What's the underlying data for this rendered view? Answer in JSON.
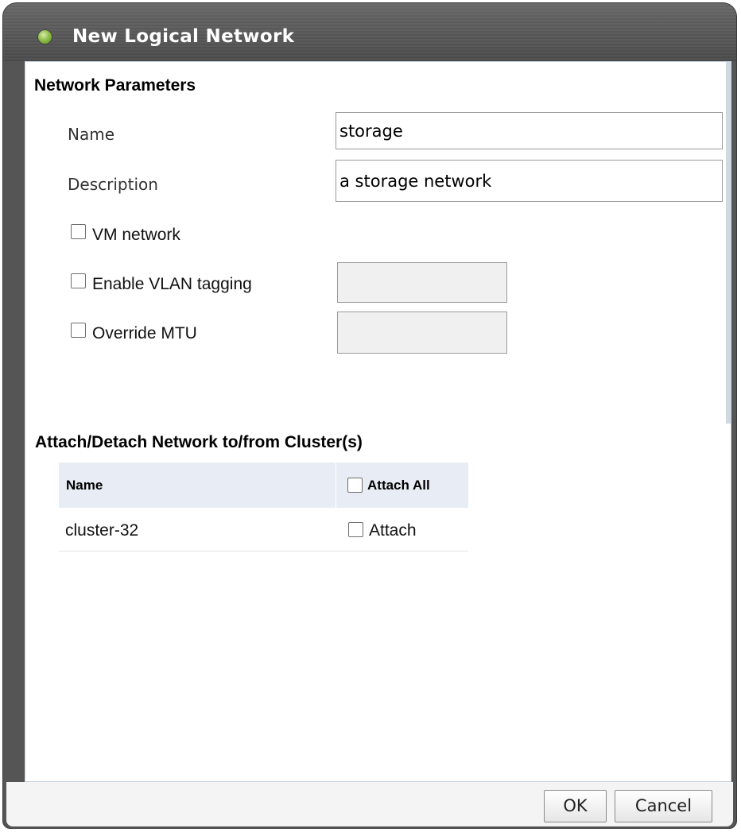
{
  "dialog": {
    "title": "New Logical Network"
  },
  "network_parameters": {
    "heading": "Network Parameters",
    "name_label": "Name",
    "name_value": "storage",
    "description_label": "Description",
    "description_value": "a storage network",
    "vm_network": {
      "label": "VM network",
      "checked": false
    },
    "vlan_tagging": {
      "label": "Enable VLAN tagging",
      "checked": false,
      "value": ""
    },
    "override_mtu": {
      "label": "Override MTU",
      "checked": false,
      "value": ""
    }
  },
  "clusters": {
    "heading": "Attach/Detach Network to/from Cluster(s)",
    "columns": {
      "name": "Name",
      "attach_all": "Attach All"
    },
    "rows": [
      {
        "name": "cluster-32",
        "attach_label": "Attach",
        "attached": false
      }
    ]
  },
  "footer": {
    "ok_label": "OK",
    "cancel_label": "Cancel"
  },
  "colors": {
    "title_bar": "#555555",
    "status_dot": "#8fbf48",
    "table_header": "#e8edf5"
  }
}
